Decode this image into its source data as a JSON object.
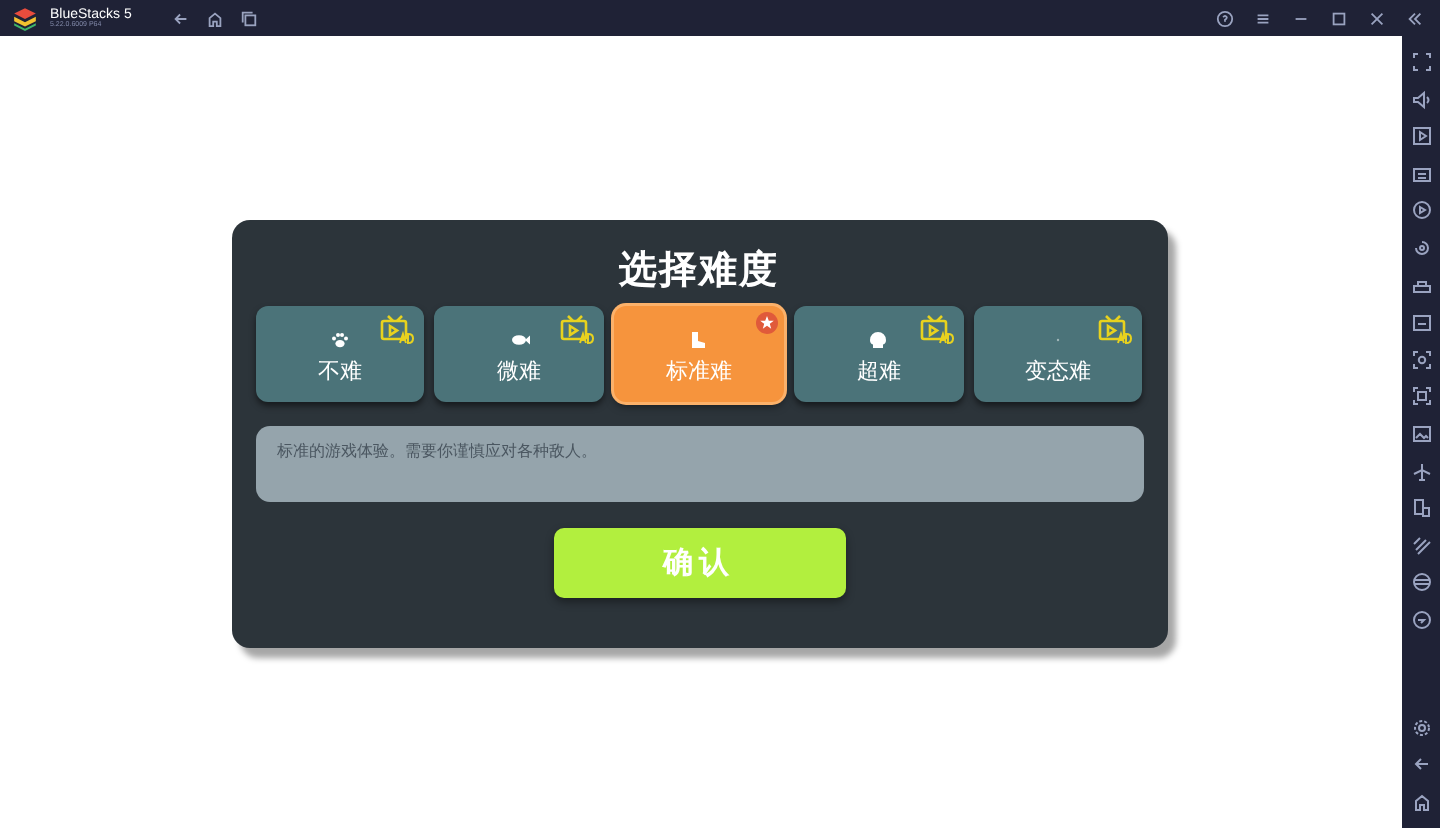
{
  "window": {
    "title": "BlueStacks 5",
    "version": "5.22.0.6009 P64"
  },
  "dialog": {
    "title": "选择难度",
    "options": [
      {
        "label": "不难",
        "kind": "paw",
        "selected": false,
        "ad": true
      },
      {
        "label": "微难",
        "kind": "fish",
        "selected": false,
        "ad": true
      },
      {
        "label": "标准难",
        "kind": "boot",
        "selected": true,
        "ad": false
      },
      {
        "label": "超难",
        "kind": "skull",
        "selected": false,
        "ad": true
      },
      {
        "label": "变态难",
        "kind": "dot",
        "selected": false,
        "ad": true
      }
    ],
    "description": "标准的游戏体验。需要你谨慎应对各种敌人。",
    "confirm": "确认"
  }
}
